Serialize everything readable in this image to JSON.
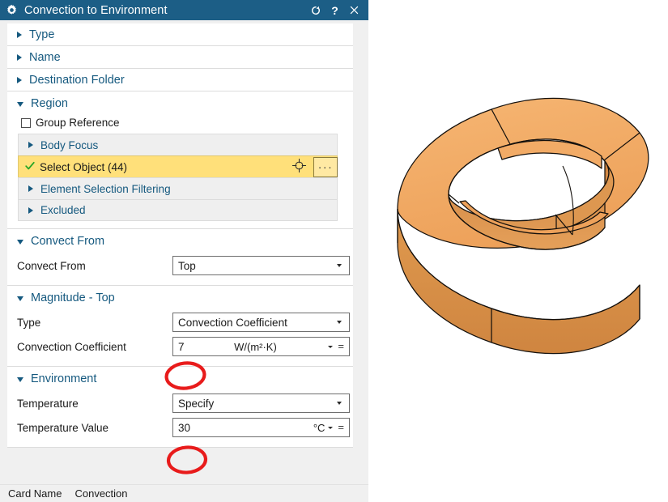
{
  "dialog": {
    "title": "Convection to Environment",
    "icons": {
      "gear": "gear-icon",
      "reset": "reset-icon",
      "help": "help-icon",
      "close": "close-icon"
    },
    "titlebar_buttons": {
      "reset_label": "↻",
      "help_label": "?",
      "close_label": "✕"
    },
    "collapsed_groups": [
      {
        "label": "Type"
      },
      {
        "label": "Name"
      },
      {
        "label": "Destination Folder"
      }
    ],
    "region": {
      "header": "Region",
      "group_reference": {
        "label": "Group Reference",
        "checked": false
      },
      "rows": [
        {
          "label": "Body Focus",
          "selected": false
        },
        {
          "label": "Select Object (44)",
          "selected": true,
          "dots_label": "···"
        },
        {
          "label": "Element Selection Filtering",
          "selected": false
        },
        {
          "label": "Excluded",
          "selected": false
        }
      ]
    },
    "convect_from": {
      "header": "Convect From",
      "field_label": "Convect From",
      "value": "Top"
    },
    "magnitude": {
      "header": "Magnitude - Top",
      "type_label": "Type",
      "type_value": "Convection Coefficient",
      "coefficient_label": "Convection Coefficient",
      "coefficient_value": "7",
      "coefficient_unit": "W/(m²·K)",
      "equals_label": "="
    },
    "environment": {
      "header": "Environment",
      "temperature_label": "Temperature",
      "temperature_value": "Specify",
      "temperature_value_label": "Temperature Value",
      "temperature_number": "30",
      "temperature_unit": "°C",
      "equals_label": "="
    },
    "status": {
      "label": "Card Name",
      "value": "Convection"
    }
  },
  "viewport": {
    "model_name": "oval-ring-solid-model"
  },
  "annotations": [
    {
      "name": "highlight-convection-coefficient",
      "color": "#e81b1b"
    },
    {
      "name": "highlight-temperature-value",
      "color": "#e81b1b"
    }
  ],
  "colors": {
    "titlebar": "#1c5e86",
    "link": "#15597f",
    "selection": "#ffe07a",
    "model_top": "#f0a860",
    "model_side": "#d98c46",
    "annotation": "#e81b1b"
  }
}
